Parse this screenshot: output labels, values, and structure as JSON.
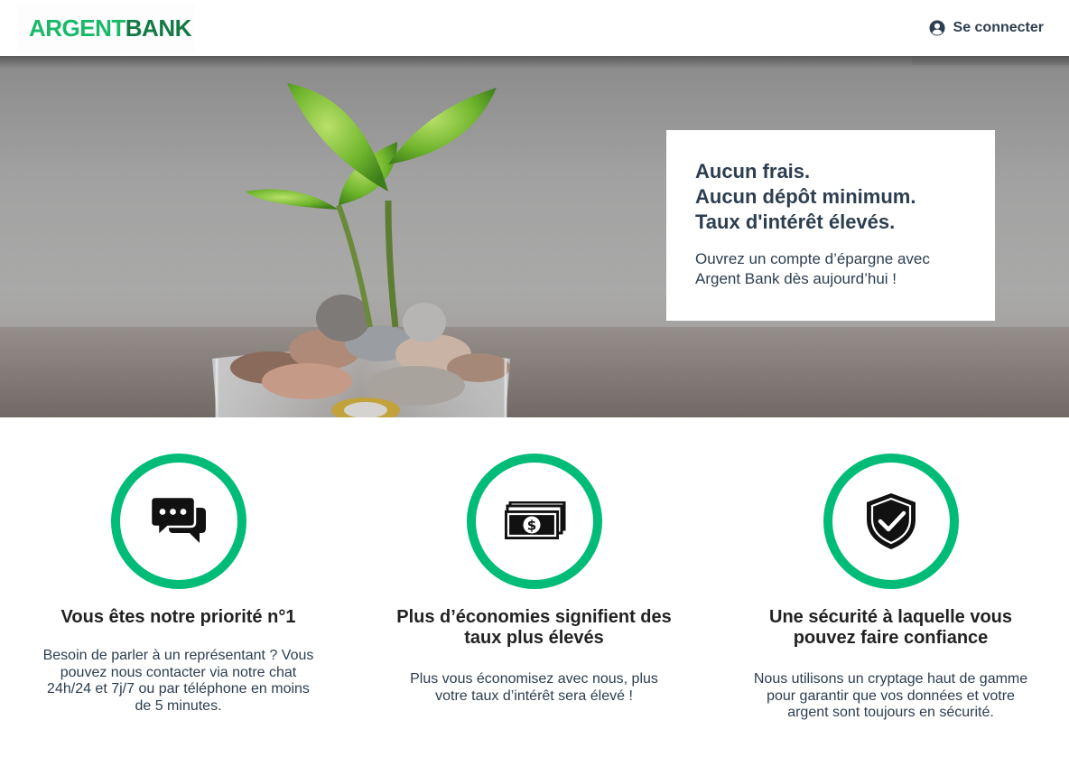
{
  "nav": {
    "logo_part1": "ARGENT",
    "logo_part2": "BANK",
    "signin_label": "Se connecter",
    "signin_icon": "user-circle-icon"
  },
  "hero": {
    "subtitles": [
      "Aucun frais.",
      "Aucun dépôt minimum.",
      "Taux d'intérêt élevés."
    ],
    "text_line1": "Ouvrez un compte d’épargne avec",
    "text_line2": "Argent Bank dès aujourd’hui !",
    "image": "plant-in-coins-jar"
  },
  "features": [
    {
      "icon": "chat-icon",
      "title_lines": [
        "Vous êtes notre priorité n°1"
      ],
      "text_lines": [
        "Besoin de parler à un représentant ? Vous",
        "pouvez nous contacter via notre chat",
        "24h/24 et 7j/7 ou par téléphone en moins",
        "de 5 minutes."
      ]
    },
    {
      "icon": "money-icon",
      "title_lines": [
        "Plus d’économies signifient des",
        "taux plus élevés"
      ],
      "text_lines": [
        "Plus vous économisez avec nous, plus",
        "votre taux d’intérêt sera élevé !"
      ]
    },
    {
      "icon": "security-icon",
      "title_lines": [
        "Une sécurité à laquelle vous",
        "pouvez faire confiance"
      ],
      "text_lines": [
        "Nous utilisons un cryptage haut de gamme",
        "pour garantir que vos données et votre",
        "argent sont toujours en sécurité."
      ]
    }
  ],
  "colors": {
    "brand_green": "#00bc77",
    "logo_light": "#19b96a",
    "logo_dark": "#137a46",
    "text": "#2c3e50"
  }
}
